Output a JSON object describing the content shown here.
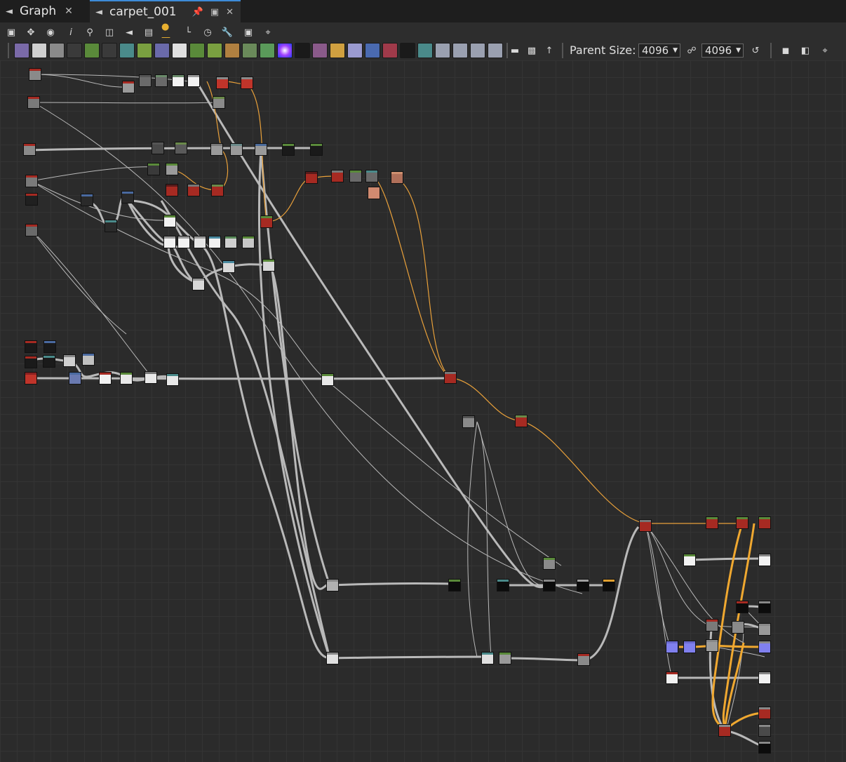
{
  "tabs": [
    {
      "label": "Graph",
      "icon": "graph-icon"
    },
    {
      "label": "carpet_001",
      "icon": "graph-icon",
      "active": true
    }
  ],
  "toolbar": {
    "parent_size_label": "Parent Size:",
    "width_value": "4096",
    "height_value": "4096"
  },
  "colors": {
    "accent": "#3d8bd8",
    "wire": "#b9b9b9",
    "wire_orange": "#e8a03a",
    "node_red": "#a62a22",
    "node_white": "#f2f2f2",
    "node_gray": "#8c8c8c",
    "node_dark": "#0c0c0c",
    "node_purple": "#8080ee"
  }
}
